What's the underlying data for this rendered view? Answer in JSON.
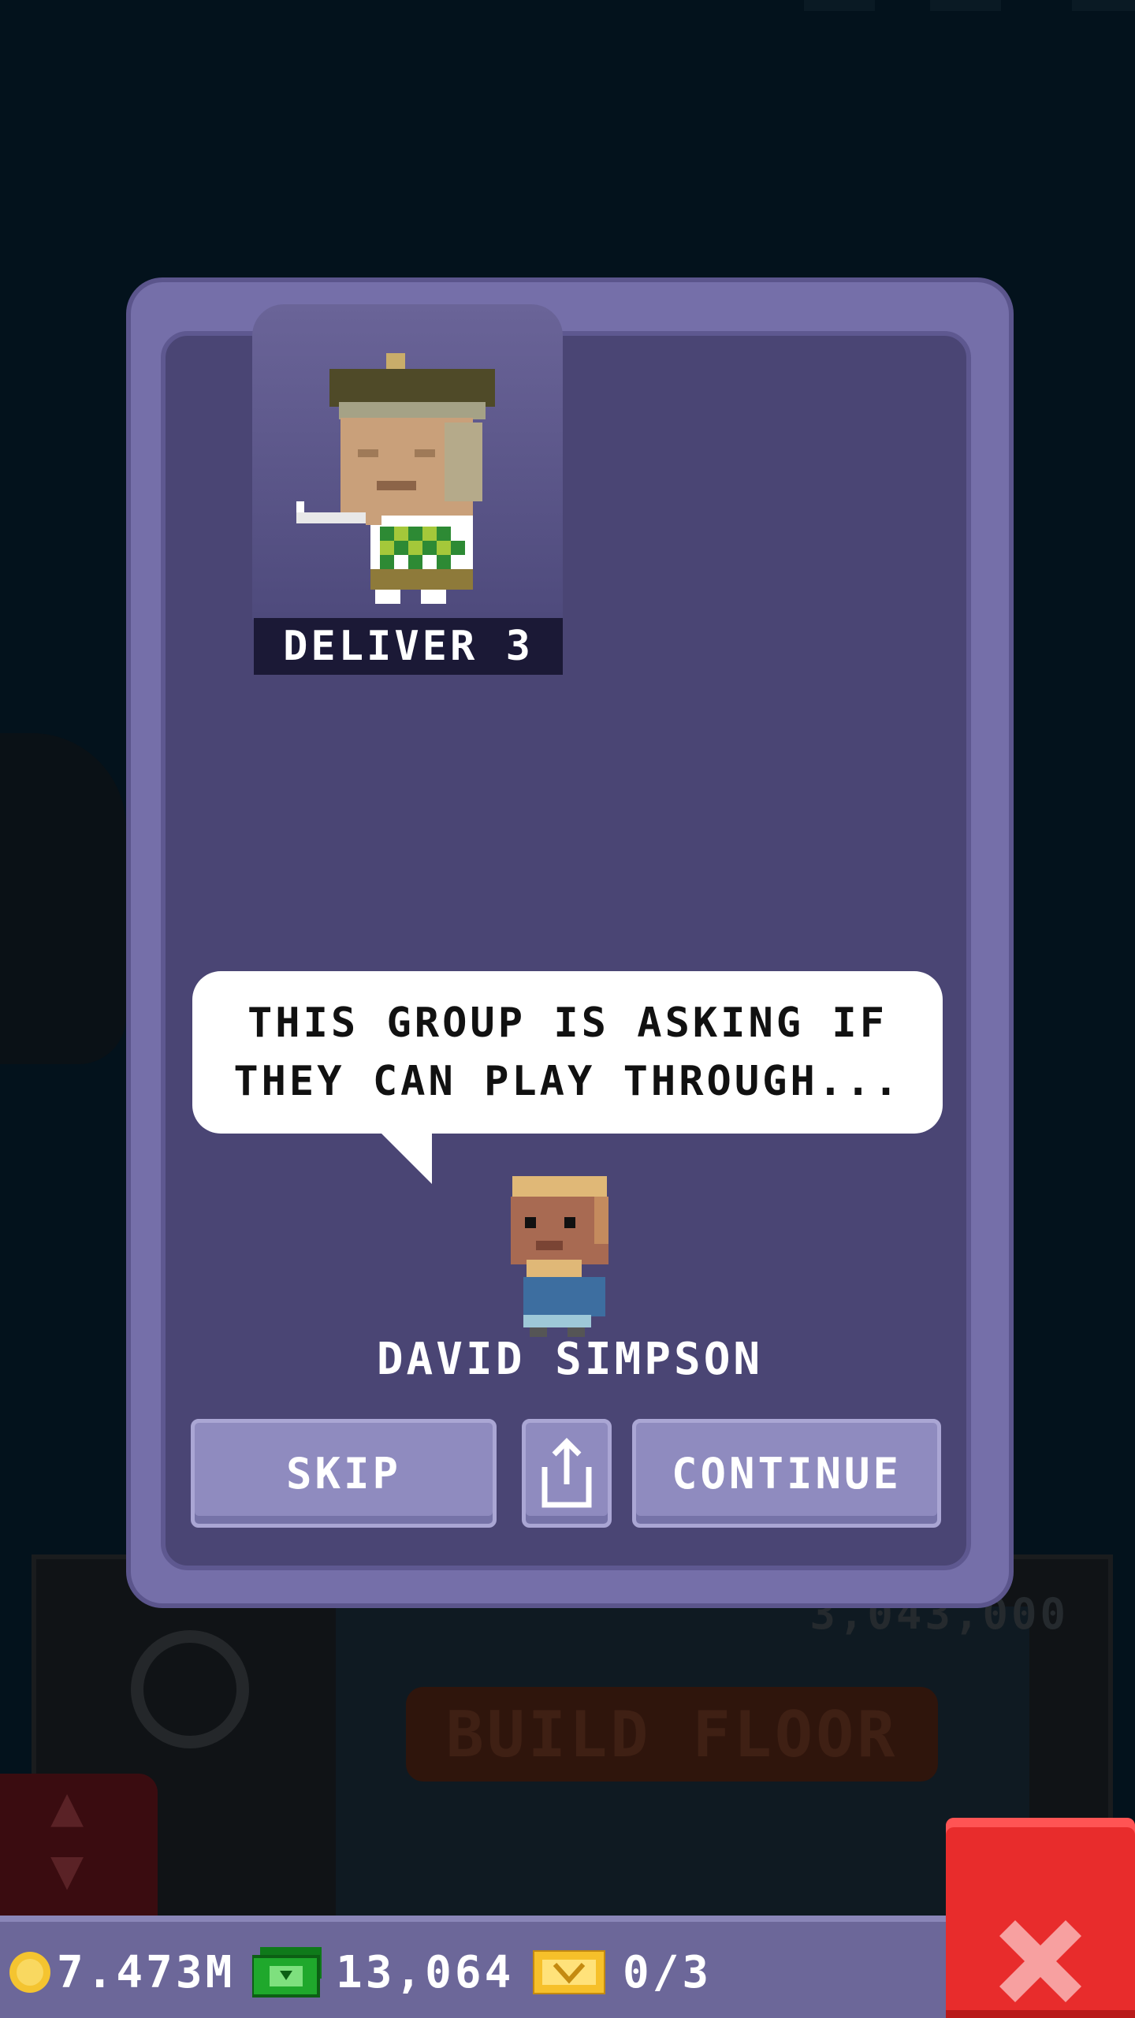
{
  "game": {
    "background": {
      "floor_price": "3,043,000",
      "build_floor_label": "BUILD FLOOR"
    },
    "dialog": {
      "task_label": "DELIVER 3",
      "message_line1": "THIS GROUP IS ASKING IF",
      "message_line2": "THEY CAN PLAY THROUGH...",
      "speaker_name": "DAVID SIMPSON",
      "buttons": {
        "skip": "SKIP",
        "share_icon": "share-icon",
        "continue": "CONTINUE"
      }
    },
    "bottom_bar": {
      "coins": "7.473M",
      "bux": "13,064",
      "tickets": "0/3"
    },
    "close_icon": "close-icon"
  },
  "colors": {
    "dialog_frame": "#756fa9",
    "dialog_inner": "#4a4574",
    "button": "#8f8bbf",
    "close_button": "#e82c2c",
    "bottom_bar": "#6c6799"
  }
}
